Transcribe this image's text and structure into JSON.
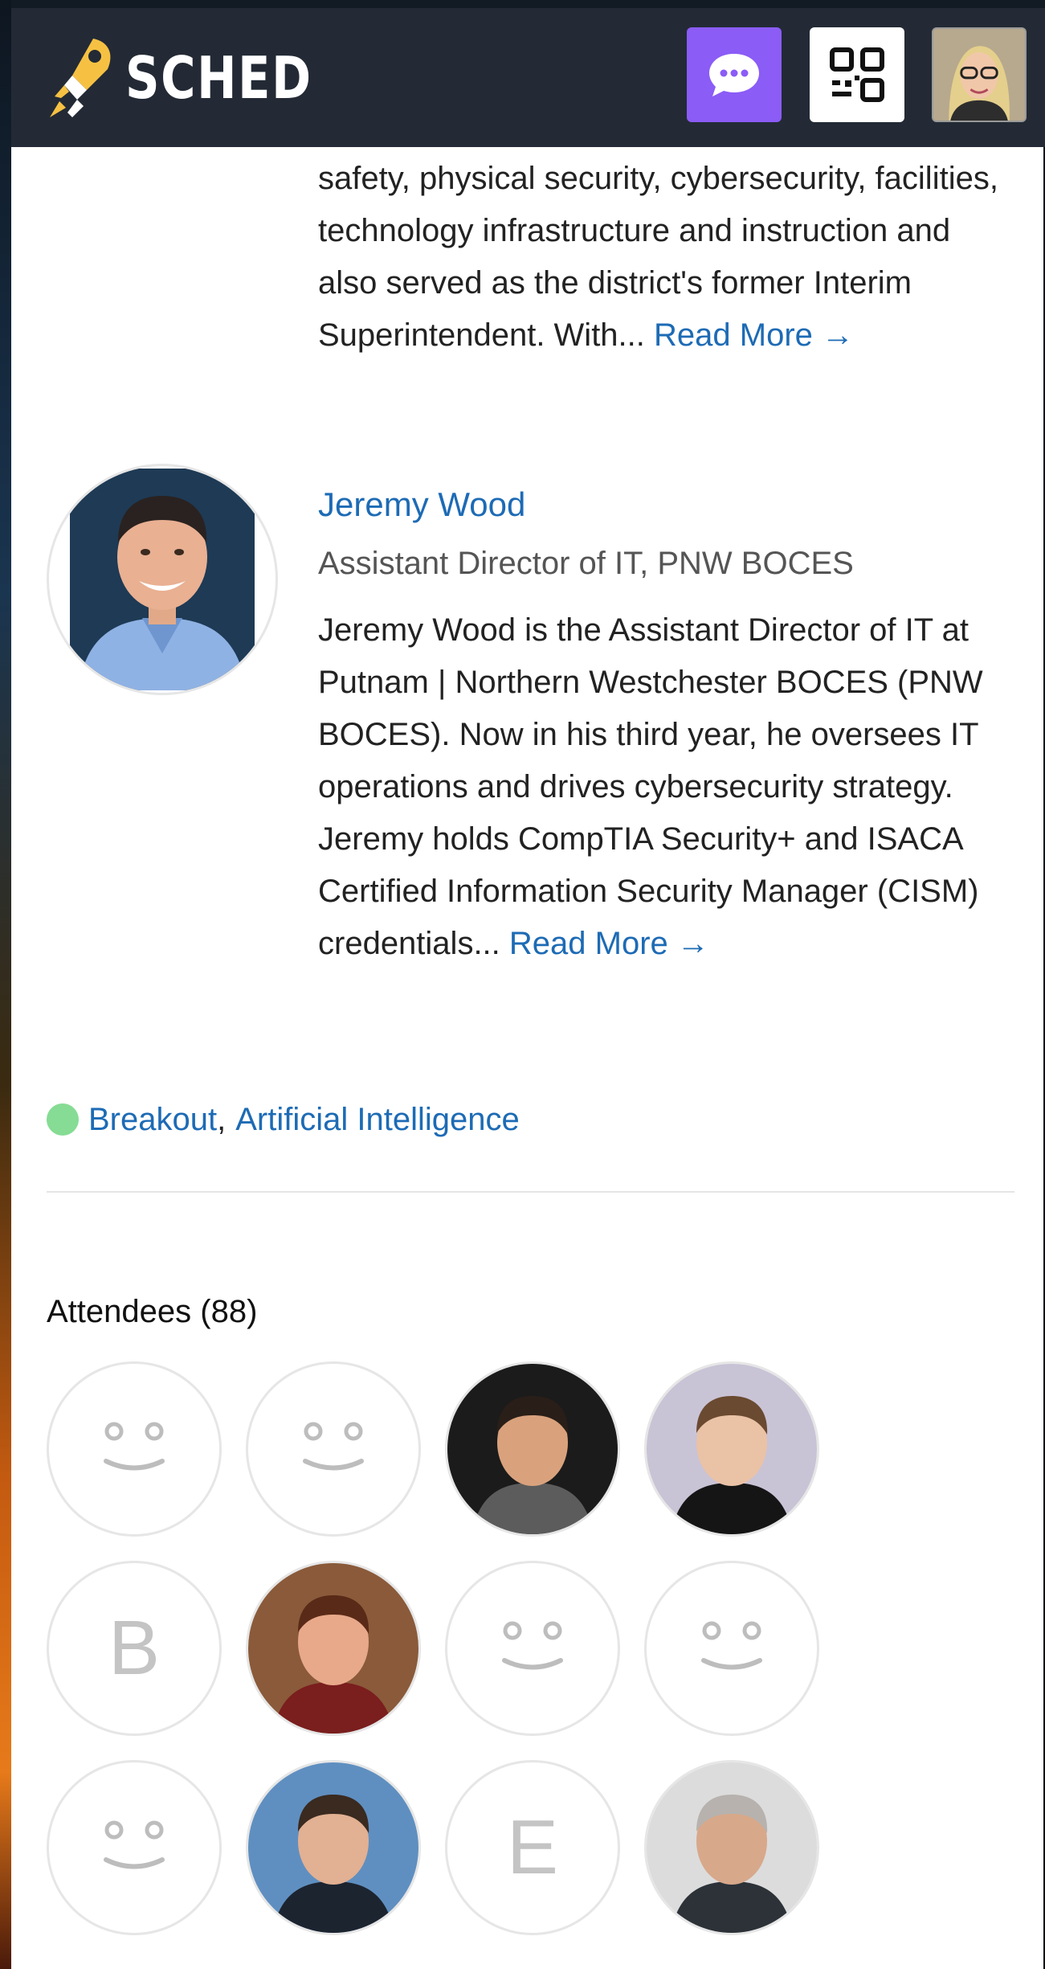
{
  "header": {
    "logo_text": "SCHED",
    "chat_icon": "chat-bubble-icon",
    "qr_icon": "qr-code-icon",
    "accent_color": "#8b5cf6"
  },
  "previous_speaker": {
    "bio_text": "safety, physical security, cybersecurity, facilities, technology infrastructure and instruction and also served as the district's former Interim Superintendent. With... ",
    "read_more": "Read More →"
  },
  "speaker": {
    "name": "Jeremy Wood",
    "role": "Assistant Director of IT, PNW BOCES",
    "bio_text": "Jeremy Wood is the Assistant Director of IT at Putnam | Northern Westchester BOCES (PNW BOCES). Now in his third year, he oversees IT operations and drives cybersecurity strategy. Jeremy holds CompTIA Security+ and ISACA  Certified Information Security Manager (CISM) credentials... ",
    "read_more": "Read More →"
  },
  "tags": {
    "dot_color": "#86dc94",
    "items": [
      "Breakout",
      "Artificial Intelligence"
    ],
    "separator": ","
  },
  "attendees": {
    "title": "Attendees (88)",
    "items": [
      {
        "type": "smiley"
      },
      {
        "type": "smiley"
      },
      {
        "type": "photo"
      },
      {
        "type": "photo"
      },
      {
        "type": "letter",
        "letter": "B"
      },
      {
        "type": "photo"
      },
      {
        "type": "smiley"
      },
      {
        "type": "smiley"
      },
      {
        "type": "smiley"
      },
      {
        "type": "photo"
      },
      {
        "type": "letter",
        "letter": "E"
      },
      {
        "type": "photo"
      }
    ]
  }
}
